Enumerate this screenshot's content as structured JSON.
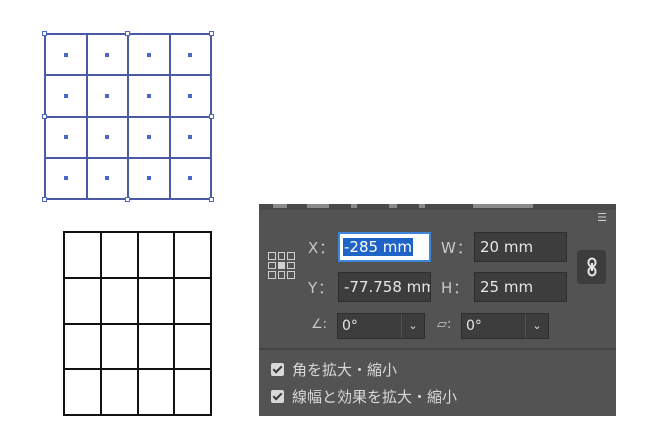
{
  "transform_panel": {
    "menu_icon": "panel-menu-icon",
    "x": {
      "label": "X：",
      "value": "-285 mm"
    },
    "y": {
      "label": "Y：",
      "value": "-77.758 mm"
    },
    "w": {
      "label": "W：",
      "value": "20 mm"
    },
    "h": {
      "label": "H：",
      "value": "25 mm"
    },
    "rotate": {
      "icon": "rotate-angle-icon",
      "value": "0°"
    },
    "shear": {
      "icon": "shear-angle-icon",
      "value": "0°"
    },
    "link_icon": "link-proportions-icon",
    "reference_point_icon": "reference-point-icon",
    "options": [
      {
        "label": "角を拡大・縮小",
        "checked": true
      },
      {
        "label": "線幅と効果を拡大・縮小",
        "checked": true
      }
    ]
  },
  "colors": {
    "panel_bg": "#535353",
    "field_bg": "#3d3d3d",
    "selection_blue": "#4a66c8",
    "focus_blue": "#3f86d9"
  }
}
